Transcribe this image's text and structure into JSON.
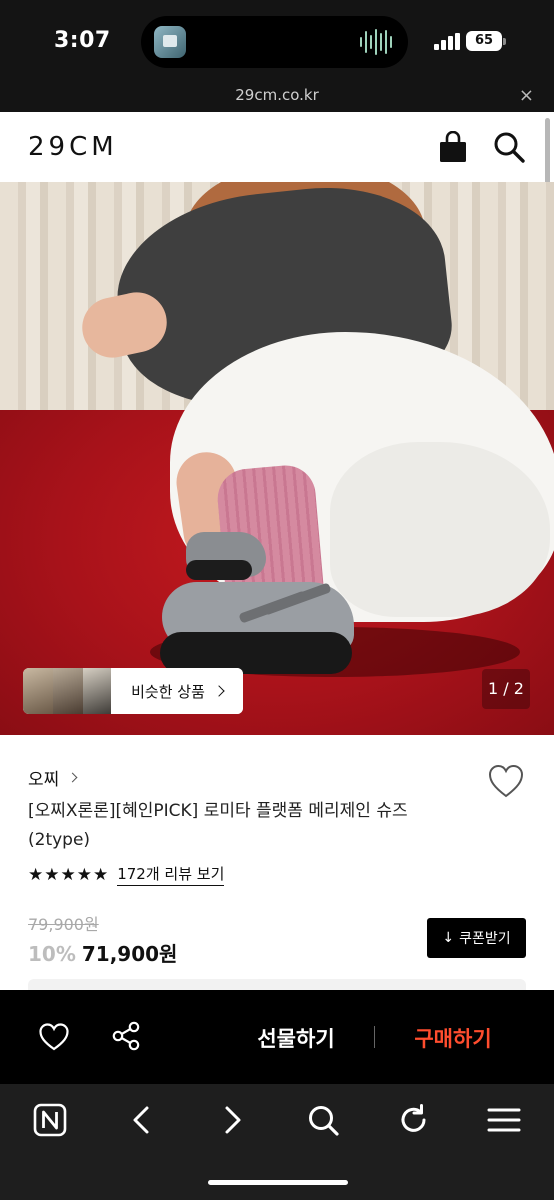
{
  "status_bar": {
    "time": "3:07",
    "battery": "65"
  },
  "browser": {
    "url": "29cm.co.kr",
    "close_glyph": "×"
  },
  "header": {
    "logo": "29CM"
  },
  "gallery": {
    "similar_label": "비슷한 상품",
    "counter": "1 / 2"
  },
  "product": {
    "brand": "오찌",
    "title": "[오찌X론론][혜인PICK] 로미타 플랫폼 메리제인 슈즈 (2type)",
    "stars": "★★★★★",
    "rating": 5,
    "review_link": "172개 리뷰 보기",
    "original_price": "79,900원",
    "discount": "10%",
    "price": "71,900원",
    "coupon_label": "쿠폰받기",
    "coupon_glyph": "↓"
  },
  "purchase_bar": {
    "gift_label": "선물하기",
    "buy_label": "구매하기"
  },
  "colors": {
    "accent": "#ff4d2e",
    "dark": "#000000",
    "status_bg": "#141414"
  }
}
